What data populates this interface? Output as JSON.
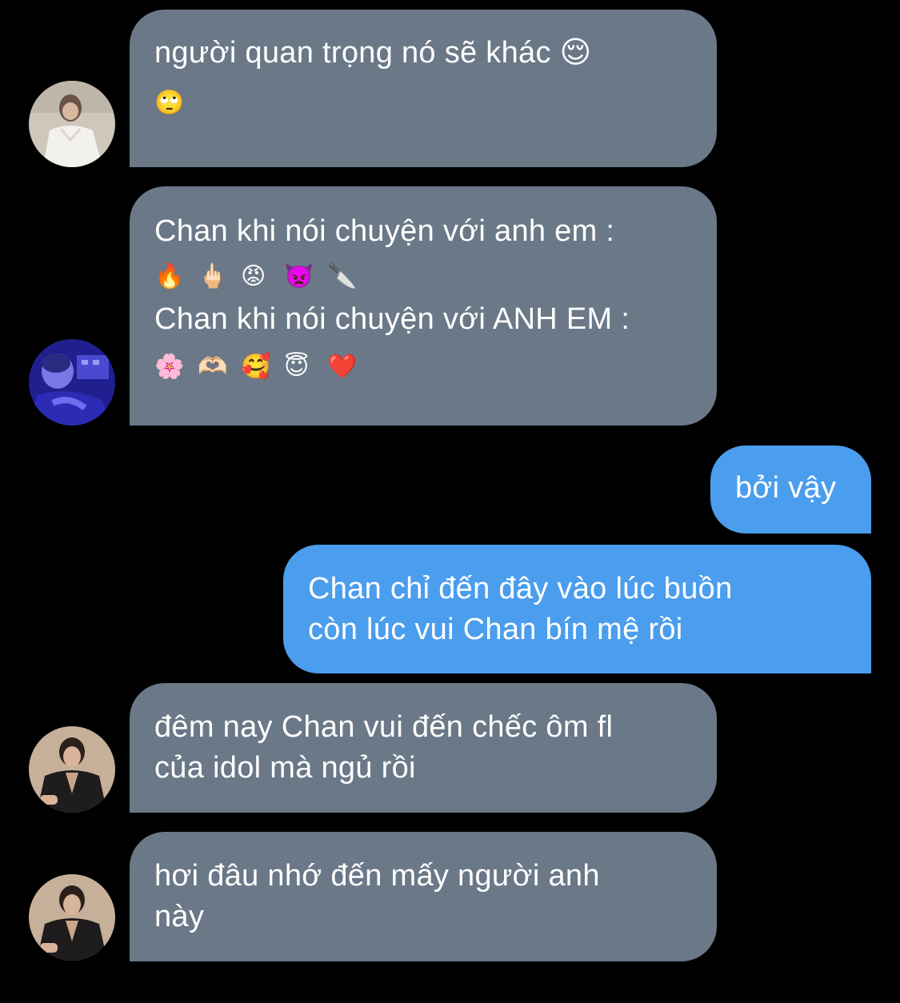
{
  "messages": [
    {
      "side": "received",
      "avatar": "avatar-white-shirt",
      "text": "người quan trọng nó sẽ khác 😌",
      "emojis": [
        "🙄"
      ]
    },
    {
      "side": "received",
      "avatar": "avatar-blue-tint",
      "line1": "Chan khi nói chuyện với anh em :",
      "emojis1": [
        "🔥",
        "🖕🏻",
        "😡",
        "👿",
        "🔪"
      ],
      "line2": "Chan khi nói chuyện với ANH EM :",
      "emojis2": [
        "🌸",
        "🫶🏻",
        "🥰",
        "😇",
        "❤️"
      ]
    },
    {
      "side": "sent",
      "text": "bởi vậy"
    },
    {
      "side": "sent",
      "line1": "Chan chỉ đến đây vào lúc buồn",
      "line2": "còn lúc vui Chan bín mệ rồi"
    },
    {
      "side": "received",
      "avatar": "avatar-black-suit",
      "line1": "đêm nay Chan vui đến chếc ôm fl",
      "line2": "của idol mà ngủ rồi"
    },
    {
      "side": "received",
      "avatar": "avatar-black-suit",
      "line1": "hơi đâu nhớ đến mấy người anh",
      "line2": "này"
    }
  ],
  "colors": {
    "background": "#000000",
    "received_bubble": "#6a7887",
    "sent_bubble": "#4b9ded",
    "text": "#ffffff"
  }
}
